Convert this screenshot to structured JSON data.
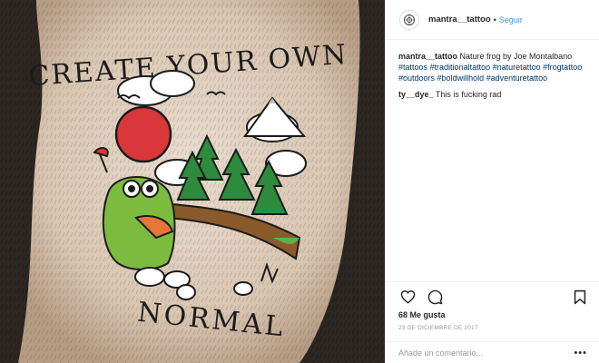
{
  "post": {
    "image_alt": "Nature frog tattoo: CREATE YOUR OWN NORMAL",
    "tattoo_text_top": "CREATE YOUR OWN",
    "tattoo_text_bottom": "NORMAL"
  },
  "header": {
    "username": "mantra__tattoo",
    "separator": "•",
    "follow_label": "Seguir"
  },
  "caption": {
    "username": "mantra__tattoo",
    "text": " Nature frog by Joe Montalbano ",
    "hashtags": [
      "#tattoos",
      "#traditionaltattoo",
      "#naturetattoo",
      "#frogtattoo",
      "#outdoors",
      "#boldwillhold",
      "#adventuretattoo"
    ]
  },
  "comments": [
    {
      "username": "ty__dye_",
      "text": " This is fucking rad"
    }
  ],
  "actions": {
    "like_icon": "heart-icon",
    "comment_icon": "comment-icon",
    "save_icon": "bookmark-icon"
  },
  "likes_text": "68 Me gusta",
  "date_text": "23 DE DICIEMBRE DE 2017",
  "add_comment": {
    "placeholder": "Añade un comentario...",
    "more_label": "•••"
  },
  "colors": {
    "accent": "#3897f0",
    "hashtag": "#003569",
    "muted": "#999999"
  }
}
